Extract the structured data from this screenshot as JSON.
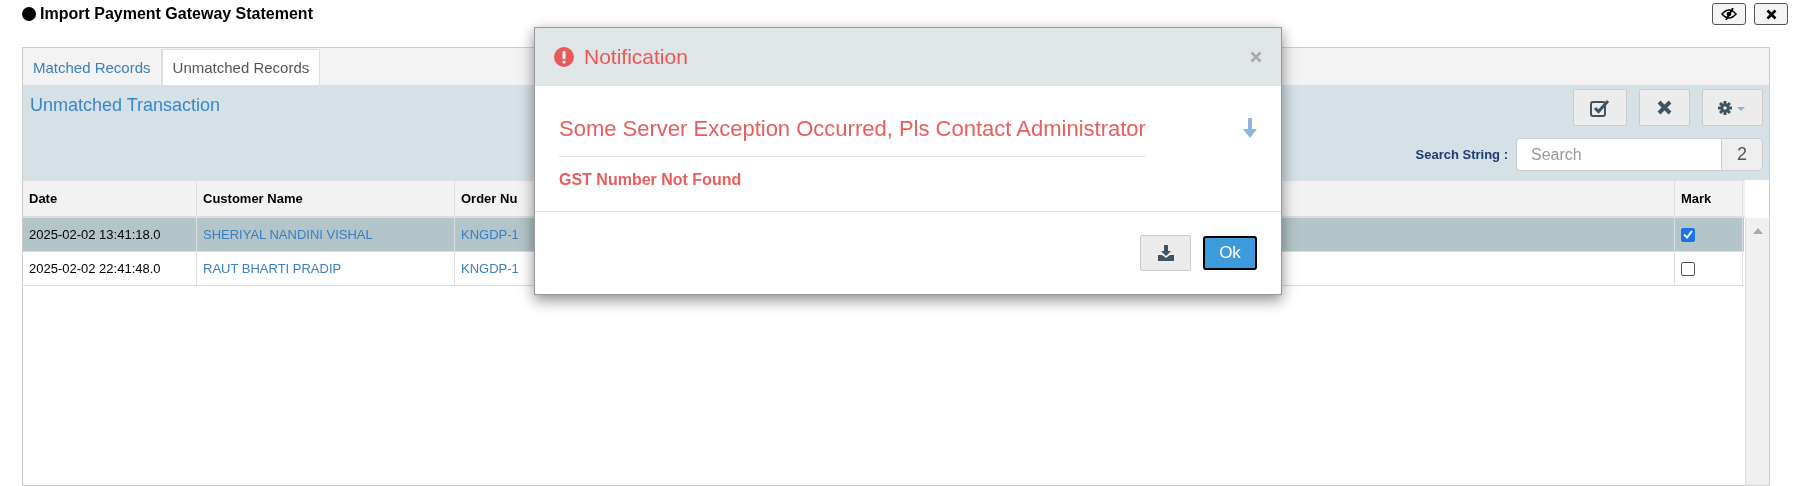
{
  "page": {
    "title": "Import Payment Gateway Statement"
  },
  "tabs": [
    {
      "label": "Matched Records",
      "selected": false
    },
    {
      "label": "Unmatched Records",
      "selected": true
    }
  ],
  "panel_title": "Unmatched Transaction",
  "search": {
    "label": "Search String :",
    "placeholder": "Search",
    "count": "2"
  },
  "table": {
    "columns": [
      "Date",
      "Customer Name",
      "Order Nu",
      "Mark"
    ],
    "rows": [
      {
        "date": "2025-02-02 13:41:18.0",
        "customer": "SHERIYAL NANDINI VISHAL",
        "order": "KNGDP-1",
        "selected": true,
        "checked": true
      },
      {
        "date": "2025-02-02 22:41:48.0",
        "customer": "RAUT BHARTI PRADIP",
        "order": "KNGDP-1",
        "selected": false,
        "checked": false
      }
    ]
  },
  "dialog": {
    "title": "Notification",
    "message": "Some Server Exception Occurred, Pls Contact Administrator",
    "detail": "GST Number Not Found",
    "ok": "Ok"
  }
}
